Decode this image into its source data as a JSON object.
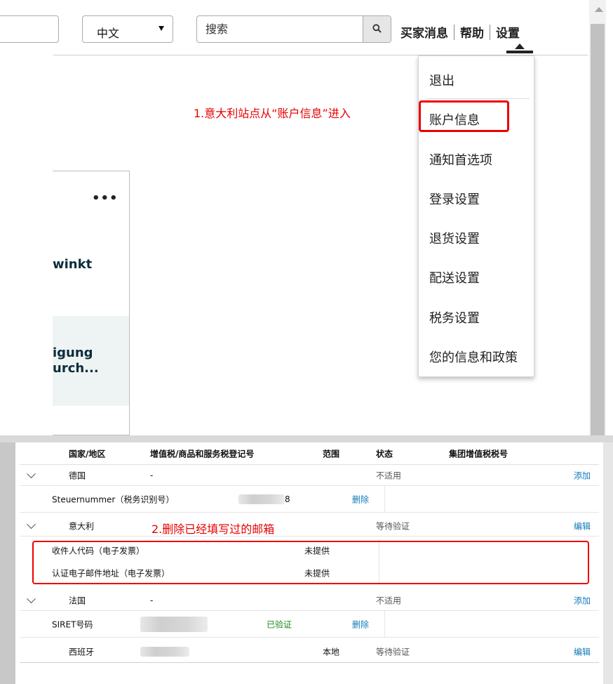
{
  "header": {
    "language": "中文",
    "search_placeholder": "搜索",
    "nav": [
      "买家消息",
      "帮助",
      "设置"
    ]
  },
  "settings_menu": {
    "items": [
      "退出",
      "账户信息",
      "通知首选项",
      "登录设置",
      "退货设置",
      "配送设置",
      "税务设置",
      "您的信息和政策"
    ]
  },
  "annotation_1": "1.意大利站点从“账户信息”进入",
  "card": {
    "more": "•••",
    "text1": "winkt",
    "text2_line1": "igung",
    "text2_line2": "urch..."
  },
  "annotation_2": "2.删除已经填写过的邮箱",
  "tax_table": {
    "headers": [
      "国家/地区",
      "增值税/商品和服务税登记号",
      "范围",
      "状态",
      "集团增值税税号"
    ],
    "rows": {
      "germany": {
        "country": "德国",
        "vat": "-",
        "status": "不适用",
        "action": "添加"
      },
      "germany_sub": {
        "label": "Steuernummer（税务识别号）",
        "value_tail": "8",
        "action": "删除"
      },
      "italy": {
        "country": "意大利",
        "status": "等待验证",
        "action": "编辑"
      },
      "italy_sub1": {
        "label": "收件人代码（电子发票）",
        "value": "未提供"
      },
      "italy_sub2": {
        "label": "认证电子邮件地址（电子发票）",
        "value": "未提供"
      },
      "france": {
        "country": "法国",
        "vat": "-",
        "status": "不适用",
        "action": "添加"
      },
      "france_sub": {
        "label": "SIRET号码",
        "verified": "已验证",
        "action": "删除"
      },
      "spain": {
        "country": "西班牙",
        "scope": "本地",
        "status": "等待验证",
        "action": "编辑"
      }
    }
  }
}
